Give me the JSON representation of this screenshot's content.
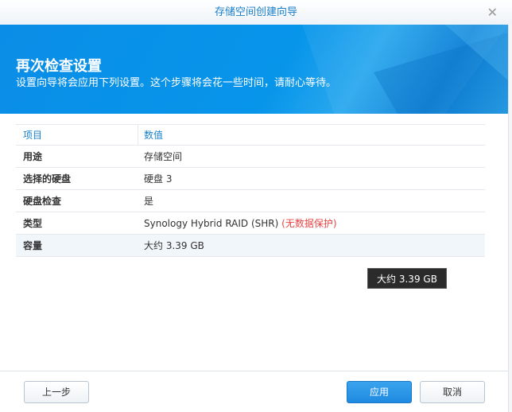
{
  "window": {
    "title": "存储空间创建向导"
  },
  "banner": {
    "title": "再次检查设置",
    "subtitle": "设置向导将会应用下列设置。这个步骤将会花一些时间，请耐心等待。"
  },
  "table": {
    "headers": [
      "项目",
      "数值"
    ],
    "rows": [
      {
        "item": "用途",
        "value": "存储空间"
      },
      {
        "item": "选择的硬盘",
        "value": "硬盘 3"
      },
      {
        "item": "硬盘检查",
        "value": "是"
      },
      {
        "item": "类型",
        "value": "Synology Hybrid RAID (SHR)",
        "note": "(无数据保护)"
      },
      {
        "item": "容量",
        "value": "大约 3.39 GB"
      }
    ]
  },
  "tooltip": "大约 3.39 GB",
  "buttons": {
    "back": "上一步",
    "apply": "应用",
    "cancel": "取消"
  },
  "colors": {
    "accent": "#1a7fc9",
    "warning": "#e64545"
  }
}
